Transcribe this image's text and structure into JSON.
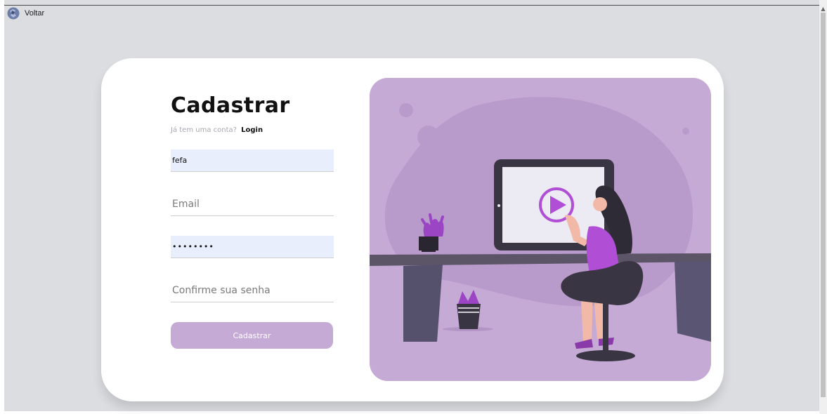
{
  "nav": {
    "back_label": "Voltar",
    "logo_icon": "puzzle-logo-icon"
  },
  "form": {
    "title": "Cadastrar",
    "have_account_text": "Já tem uma conta?",
    "login_link": "Login",
    "name_value": "fefa",
    "email_placeholder": "Email",
    "email_value": "",
    "password_value": "••••••••",
    "confirm_placeholder": "Confirme sua senha",
    "confirm_value": "",
    "submit_label": "Cadastrar"
  },
  "colors": {
    "accent": "#c6aad6",
    "autofill": "#e8eefc",
    "page_bg": "#dcdde1",
    "illustration_purple": "#b04fd6"
  },
  "illustration": {
    "icon": "woman-watching-video-illustration"
  }
}
